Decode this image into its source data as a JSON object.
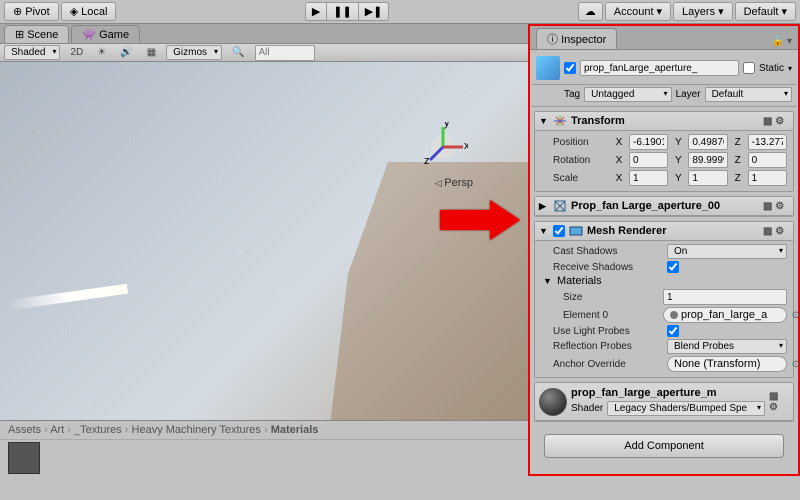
{
  "top": {
    "pivot": "Pivot",
    "local": "Local",
    "account": "Account",
    "layers": "Layers",
    "default": "Default"
  },
  "tabs": {
    "scene": "Scene",
    "game": "Game"
  },
  "sceneToolbar": {
    "shaded": "Shaded",
    "twoD": "2D",
    "gizmos": "Gizmos",
    "searchPlaceholder": "All"
  },
  "persp": "Persp",
  "breadcrumb": [
    "Assets",
    "Art",
    "_Textures",
    "Heavy Machinery Textures",
    "Materials"
  ],
  "inspector": {
    "title": "Inspector",
    "objectName": "prop_fanLarge_aperture_",
    "static": "Static",
    "tagLabel": "Tag",
    "tagValue": "Untagged",
    "layerLabel": "Layer",
    "layerValue": "Default",
    "enabled": true
  },
  "transform": {
    "title": "Transform",
    "positionLabel": "Position",
    "rotationLabel": "Rotation",
    "scaleLabel": "Scale",
    "position": {
      "x": "-6.1901",
      "y": "0.49876",
      "z": "-13.277"
    },
    "rotation": {
      "x": "0",
      "y": "89.9999",
      "z": "0"
    },
    "scale": {
      "x": "1",
      "y": "1",
      "z": "1"
    }
  },
  "meshFilter": {
    "title": "Prop_fan Large_aperture_00"
  },
  "meshRenderer": {
    "title": "Mesh Renderer",
    "castShadowsLabel": "Cast Shadows",
    "castShadowsValue": "On",
    "receiveShadowsLabel": "Receive Shadows",
    "receiveShadows": true,
    "materialsLabel": "Materials",
    "sizeLabel": "Size",
    "sizeValue": "1",
    "element0Label": "Element 0",
    "element0Value": "prop_fan_large_a",
    "useLightProbesLabel": "Use Light Probes",
    "useLightProbes": true,
    "reflectionProbesLabel": "Reflection Probes",
    "reflectionProbesValue": "Blend Probes",
    "anchorOverrideLabel": "Anchor Override",
    "anchorOverrideValue": "None (Transform)"
  },
  "material": {
    "name": "prop_fan_large_aperture_m",
    "shaderLabel": "Shader",
    "shaderValue": "Legacy Shaders/Bumped Spe"
  },
  "addComponent": "Add Component"
}
